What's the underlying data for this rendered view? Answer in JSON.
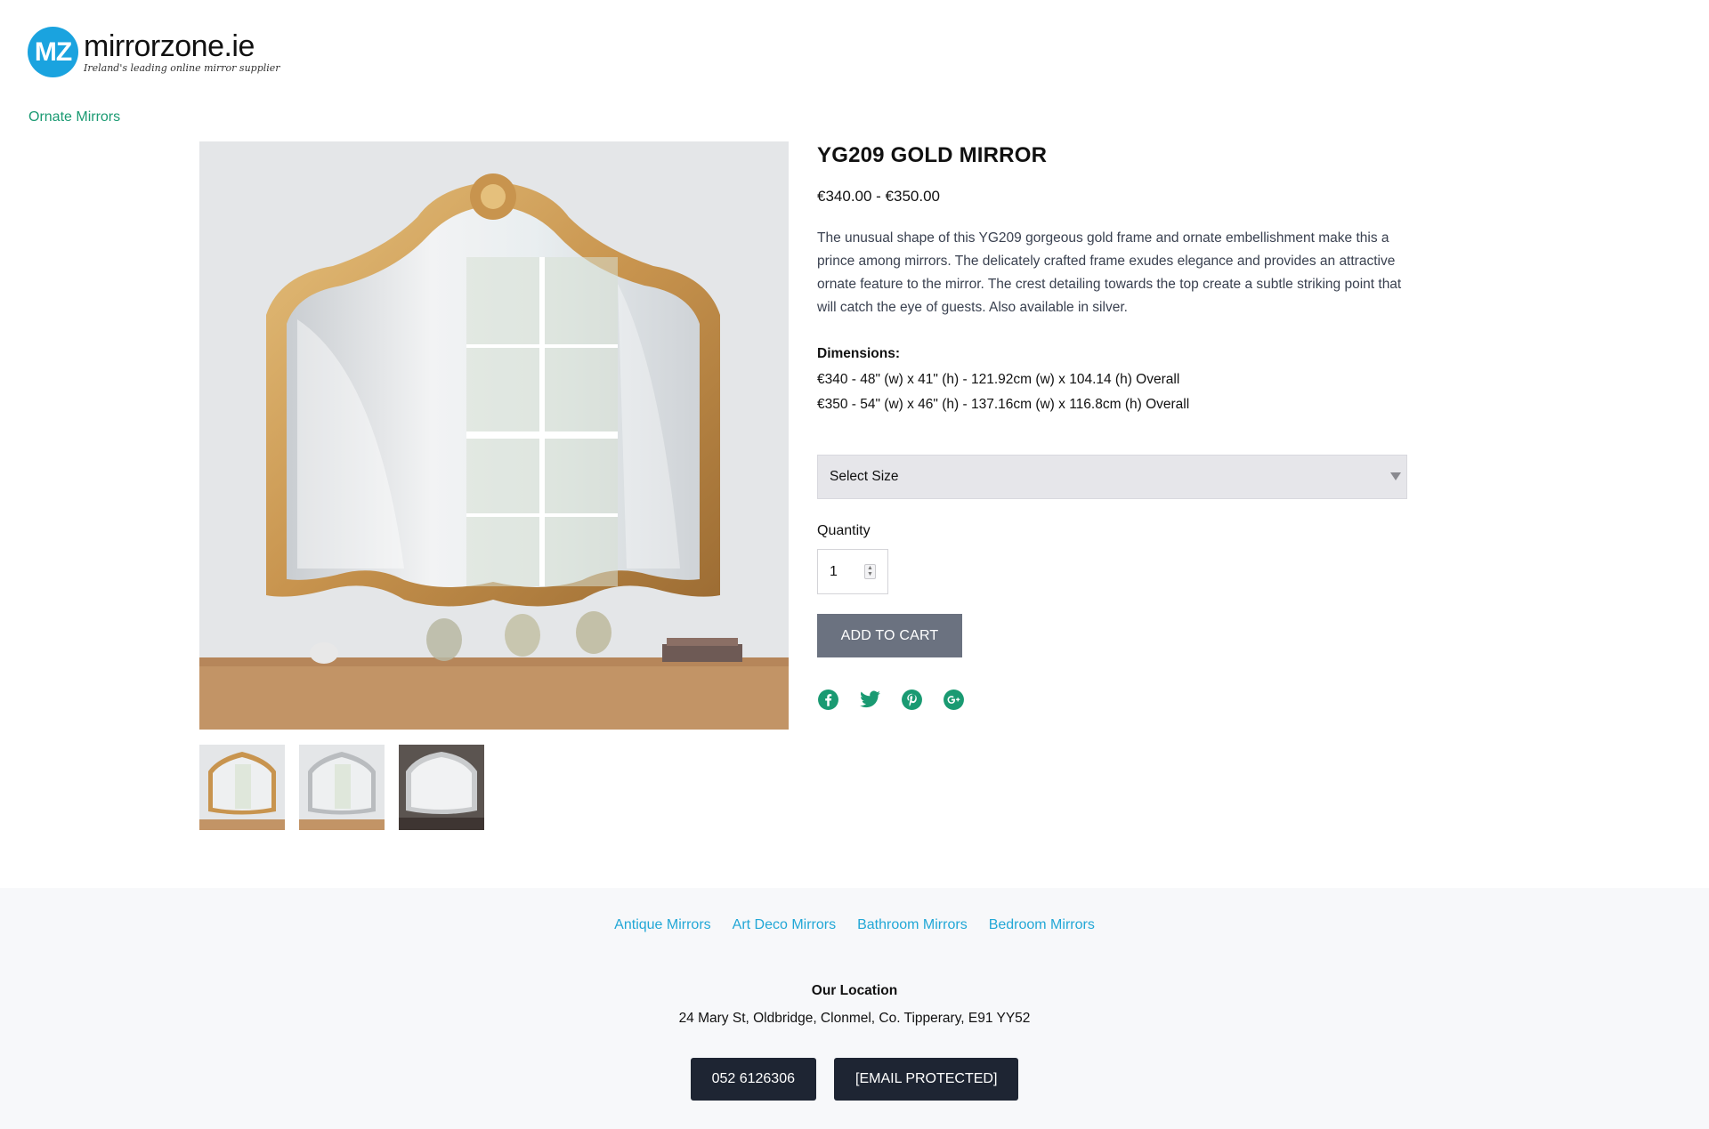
{
  "header": {
    "logo_badge": "MZ",
    "logo_name": "mirrorzone.ie",
    "logo_tagline": "Ireland's leading online mirror supplier",
    "brand_color": "#1aa3df"
  },
  "breadcrumb": {
    "label": "Ornate Mirrors"
  },
  "product": {
    "title": "YG209 GOLD MIRROR",
    "price": "€340.00 - €350.00",
    "description": "The unusual shape of this YG209 gorgeous gold frame and ornate embellishment make this a prince among mirrors. The delicately crafted frame exudes elegance and provides an attractive ornate feature to the mirror. The crest detailing towards the top create a subtle striking point that will catch the eye of guests. Also available in silver.",
    "dimensions_title": "Dimensions:",
    "dimensions": [
      "€340 - 48\" (w) x 41\" (h) - 121.92cm (w) x 104.14 (h) Overall",
      "€350 - 54\" (w) x 46\" (h) - 137.16cm (w) x 116.8cm (h) Overall"
    ],
    "size_select": {
      "selected": "Select Size"
    },
    "quantity": {
      "label": "Quantity",
      "value": "1"
    },
    "add_to_cart": "ADD TO CART",
    "thumbnails": [
      "gold-mirror",
      "silver-mirror-room",
      "silver-mirror-dark"
    ],
    "social": [
      "facebook-icon",
      "twitter-icon",
      "pinterest-icon",
      "google-plus-icon"
    ],
    "accent_color": "#1a9a72"
  },
  "footer": {
    "links": [
      "Antique Mirrors",
      "Art Deco Mirrors",
      "Bathroom Mirrors",
      "Bedroom Mirrors"
    ],
    "location_title": "Our Location",
    "address": "24 Mary St, Oldbridge, Clonmel, Co. Tipperary, E91 YY52",
    "phone": "052 6126306",
    "email": "[EMAIL PROTECTED]",
    "link_color": "#22a7d6"
  }
}
